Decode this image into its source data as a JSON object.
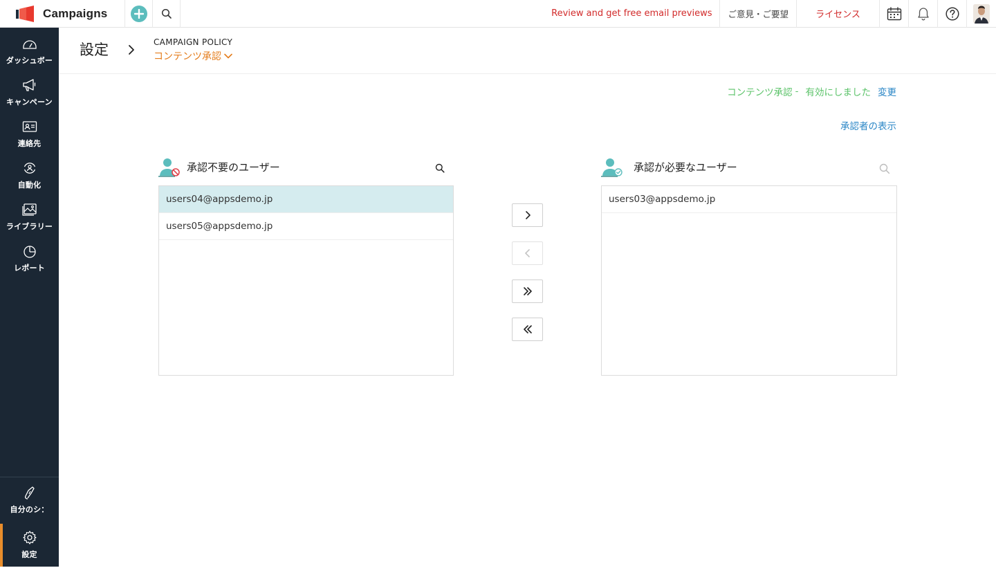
{
  "topbar": {
    "app_name": "Campaigns",
    "promo_text": "Review and get free email previews",
    "feedback_label": "ご意見・ご要望",
    "license_label": "ライセンス",
    "brand_color": "#e8392e",
    "accent_color": "#5cbdbd",
    "icons": [
      "add-icon",
      "search-icon",
      "calendar-icon",
      "bell-icon",
      "help-icon",
      "user-avatar"
    ]
  },
  "sidebar": {
    "items": [
      {
        "label": "ダッシュボー",
        "icon": "dashboard-gauge-icon"
      },
      {
        "label": "キャンペーン",
        "icon": "megaphone-icon"
      },
      {
        "label": "連絡先",
        "icon": "contact-card-icon"
      },
      {
        "label": "自動化",
        "icon": "automation-cycle-icon"
      },
      {
        "label": "ライブラリー",
        "icon": "image-library-icon"
      },
      {
        "label": "レポート",
        "icon": "pie-chart-icon"
      }
    ],
    "bottom_items": [
      {
        "label": "自分のシ：",
        "icon": "signature-pen-icon"
      },
      {
        "label": "設定",
        "icon": "gear-icon"
      }
    ],
    "active_accent": "#e98d2b"
  },
  "header": {
    "title": "設定",
    "section": "CAMPAIGN POLICY",
    "current": "コンテンツ承認"
  },
  "status": {
    "label": "コンテンツ承認",
    "separator": "-",
    "value": "有効にしました",
    "change_link": "変更"
  },
  "view_approvers_link": "承認者の表示",
  "left_panel": {
    "title": "承認不要のユーザー",
    "items": [
      "users04@appsdemo.jp",
      "users05@appsdemo.jp"
    ],
    "selected_index": 0
  },
  "right_panel": {
    "title": "承認が必要なユーザー",
    "items": [
      "users03@appsdemo.jp"
    ]
  },
  "transfer_buttons": {
    "move_right": "›",
    "move_left": "‹",
    "move_all_right": "»",
    "move_all_left": "«"
  }
}
